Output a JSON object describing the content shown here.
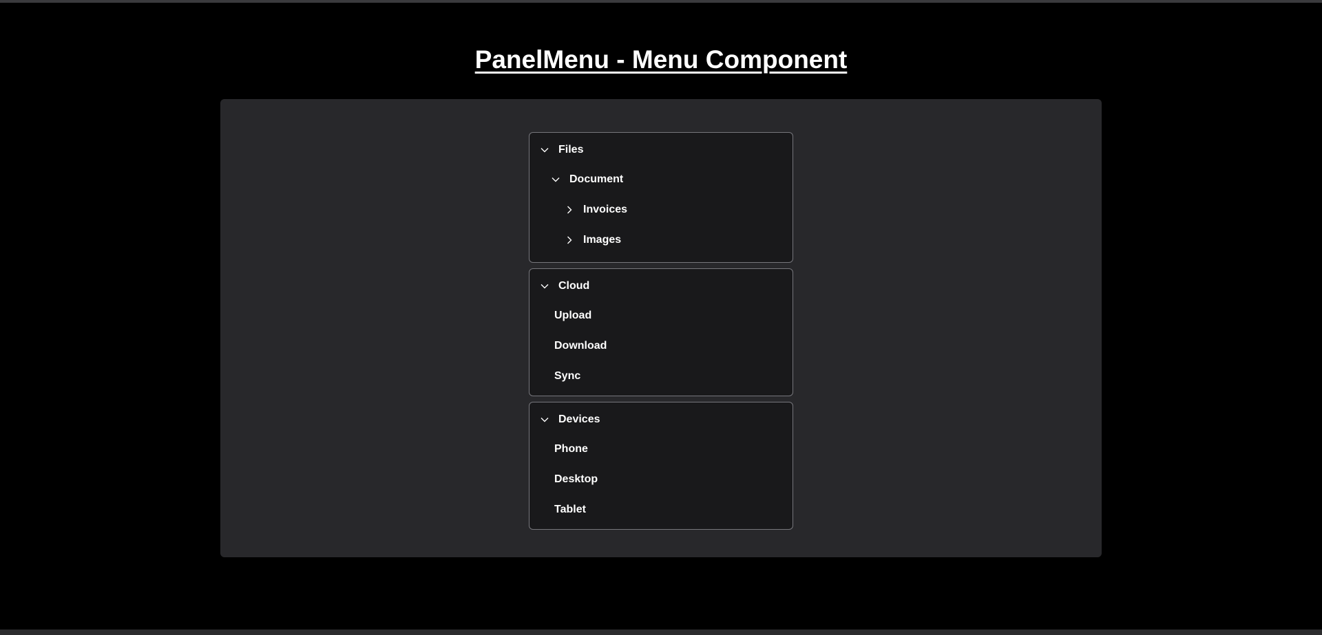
{
  "page": {
    "title": "PanelMenu - Menu Component"
  },
  "colors": {
    "background": "#000000",
    "card": "#28282b",
    "panel": "#19191b",
    "panel_border": "#77777c",
    "text": "#ffffff"
  },
  "menu": {
    "files": {
      "label": "Files",
      "icon": "chevron-down-icon",
      "document": {
        "label": "Document",
        "icon": "chevron-down-icon",
        "items": [
          {
            "label": "Invoices",
            "icon": "chevron-right-icon"
          },
          {
            "label": "Images",
            "icon": "chevron-right-icon"
          }
        ]
      }
    },
    "cloud": {
      "label": "Cloud",
      "icon": "chevron-down-icon",
      "items": [
        {
          "label": "Upload"
        },
        {
          "label": "Download"
        },
        {
          "label": "Sync"
        }
      ]
    },
    "devices": {
      "label": "Devices",
      "icon": "chevron-down-icon",
      "items": [
        {
          "label": "Phone"
        },
        {
          "label": "Desktop"
        },
        {
          "label": "Tablet"
        }
      ]
    }
  }
}
